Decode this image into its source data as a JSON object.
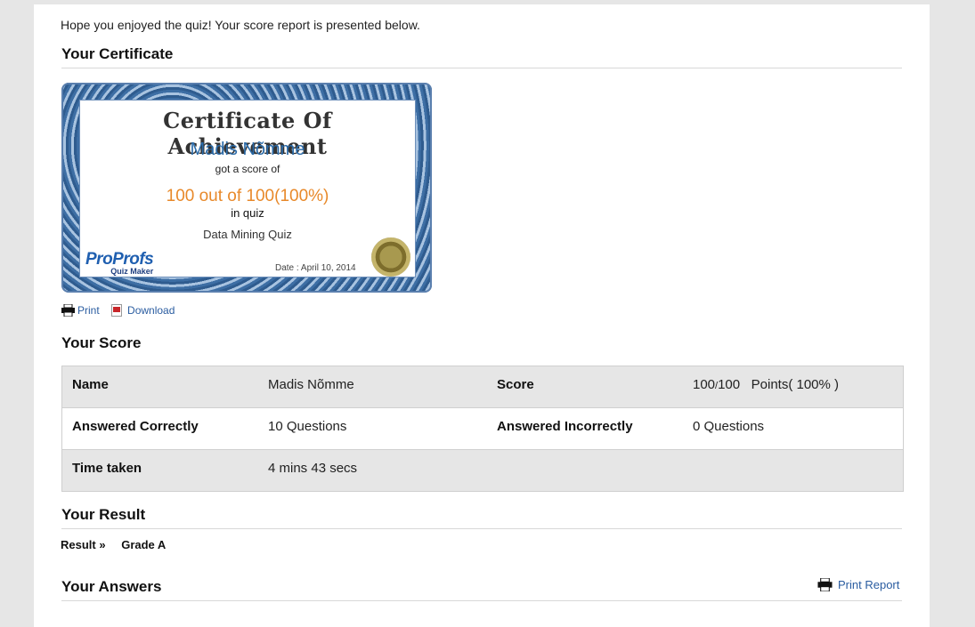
{
  "intro": "Hope you enjoyed the quiz! Your score report is presented below.",
  "sections": {
    "certificate": "Your Certificate",
    "score": "Your Score",
    "result": "Your Result",
    "answers": "Your Answers"
  },
  "certificate": {
    "title": "Certificate Of Achievement",
    "name": "Madis Nõmme",
    "got_score": "got a score of",
    "score": "100 out of 100(100%)",
    "in_quiz": "in quiz",
    "quiz_name": "Data Mining Quiz",
    "logo_pro": "ProProfs",
    "logo_maker": "Quiz Maker",
    "date": "Date : April 10, 2014"
  },
  "actions": {
    "print": "Print",
    "download": "Download"
  },
  "score_table": {
    "name_label": "Name",
    "name_value": "Madis Nõmme",
    "score_label": "Score",
    "score_obtained": "100",
    "score_slash": "/",
    "score_total": "100",
    "score_points": "Points( 100% )",
    "correct_label": "Answered Correctly",
    "correct_value": "10 Questions",
    "incorrect_label": "Answered Incorrectly",
    "incorrect_value": "0 Questions",
    "time_label": "Time taken",
    "time_value": "4 mins 43 secs"
  },
  "result": {
    "label": "Result »",
    "grade": "Grade A"
  },
  "print_report": "Print Report",
  "colors": {
    "link": "#2a5ca0",
    "cert_name": "#2a6aa8",
    "cert_score": "#e8892a",
    "row_shade": "#e6e6e6"
  }
}
